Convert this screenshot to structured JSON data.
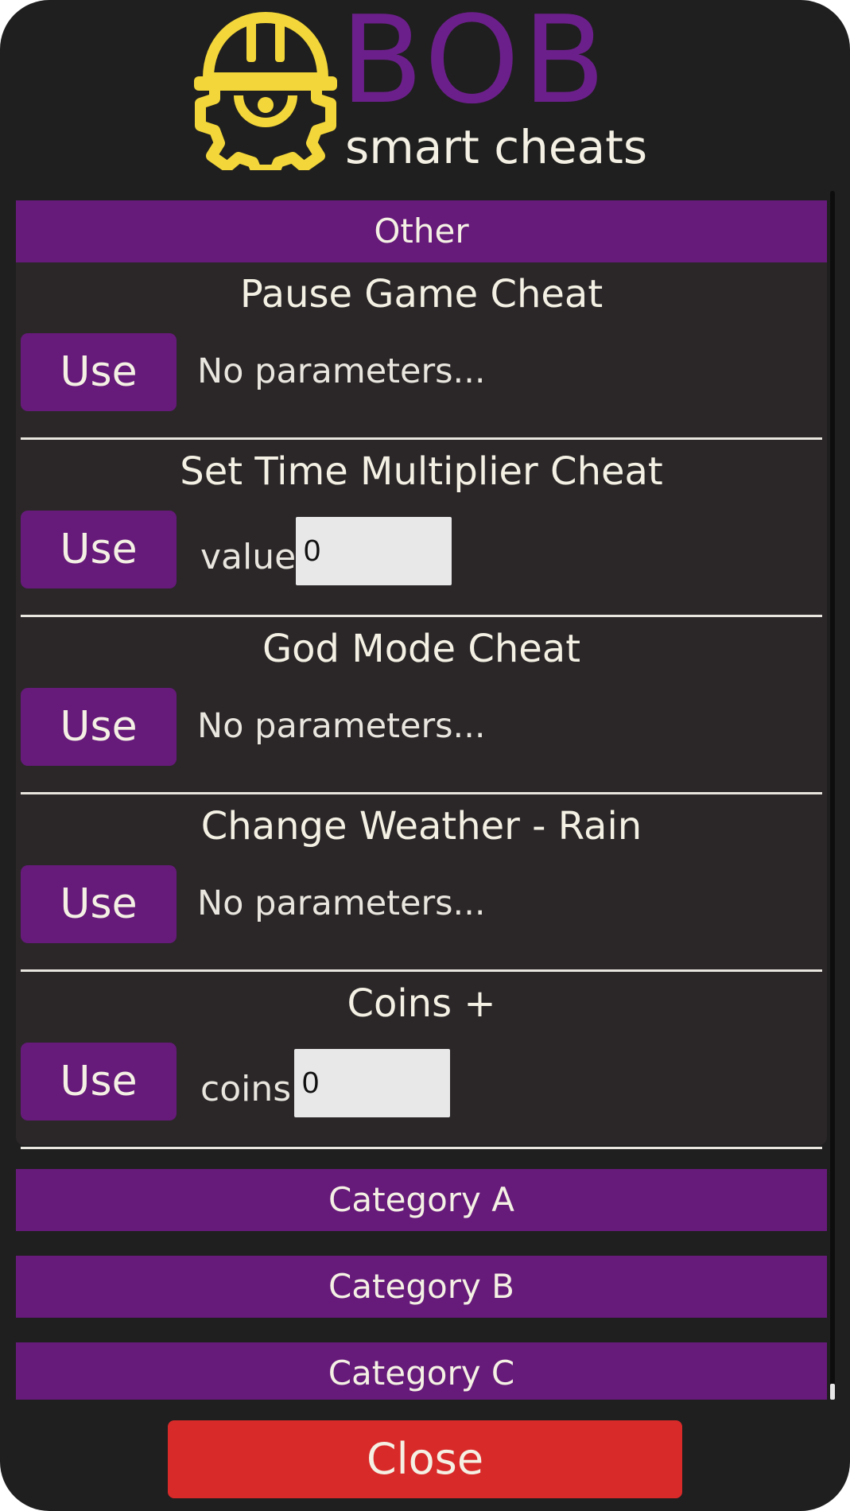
{
  "header": {
    "brand": "BOB",
    "tagline": "smart cheats",
    "logo_icon": "hardhat-gear-icon",
    "colors": {
      "brand": "#6b1f8a",
      "logo": "#f2d63a",
      "tagline": "#f4f1e4"
    }
  },
  "open_category": {
    "label": "Other",
    "cheats": [
      {
        "title": "Pause Game Cheat",
        "button": "Use",
        "params_text": "No parameters..."
      },
      {
        "title": "Set Time Multiplier Cheat",
        "button": "Use",
        "param_label": "value",
        "param_value": "0"
      },
      {
        "title": "God Mode Cheat",
        "button": "Use",
        "params_text": "No parameters..."
      },
      {
        "title": "Change Weather - Rain",
        "button": "Use",
        "params_text": "No parameters..."
      },
      {
        "title": "Coins +",
        "button": "Use",
        "param_label": "coins",
        "param_value": "0"
      }
    ]
  },
  "categories": [
    {
      "label": "Category A"
    },
    {
      "label": "Category B"
    },
    {
      "label": "Category C"
    }
  ],
  "close_button": "Close",
  "colors": {
    "accent": "#661a7a",
    "background": "#1f1f1f",
    "panel": "#2b2729",
    "close": "#d92a2a",
    "text": "#f4f1e4"
  }
}
